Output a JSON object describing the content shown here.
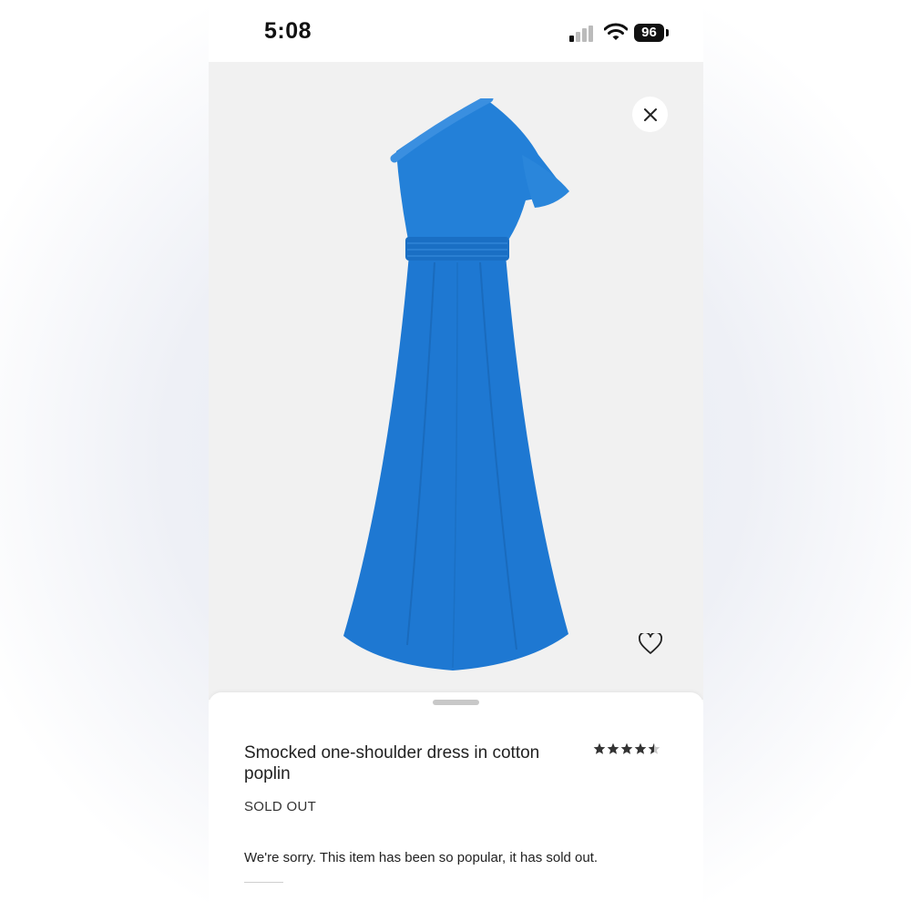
{
  "status_bar": {
    "time": "5:08",
    "battery": "96",
    "icons": [
      "signal-icon",
      "wifi-icon",
      "battery-icon"
    ]
  },
  "product_image": {
    "icons": [
      "close-icon",
      "heart-icon"
    ],
    "colors": {
      "dress": "#1e78d2",
      "background": "#f1f1f1"
    }
  },
  "product": {
    "title": "Smocked one-shoulder dress in cotton poplin",
    "rating": 4.5,
    "rating_max": 5,
    "status": "SOLD OUT",
    "message": "We're sorry. This item has been so popular, it has sold out."
  }
}
